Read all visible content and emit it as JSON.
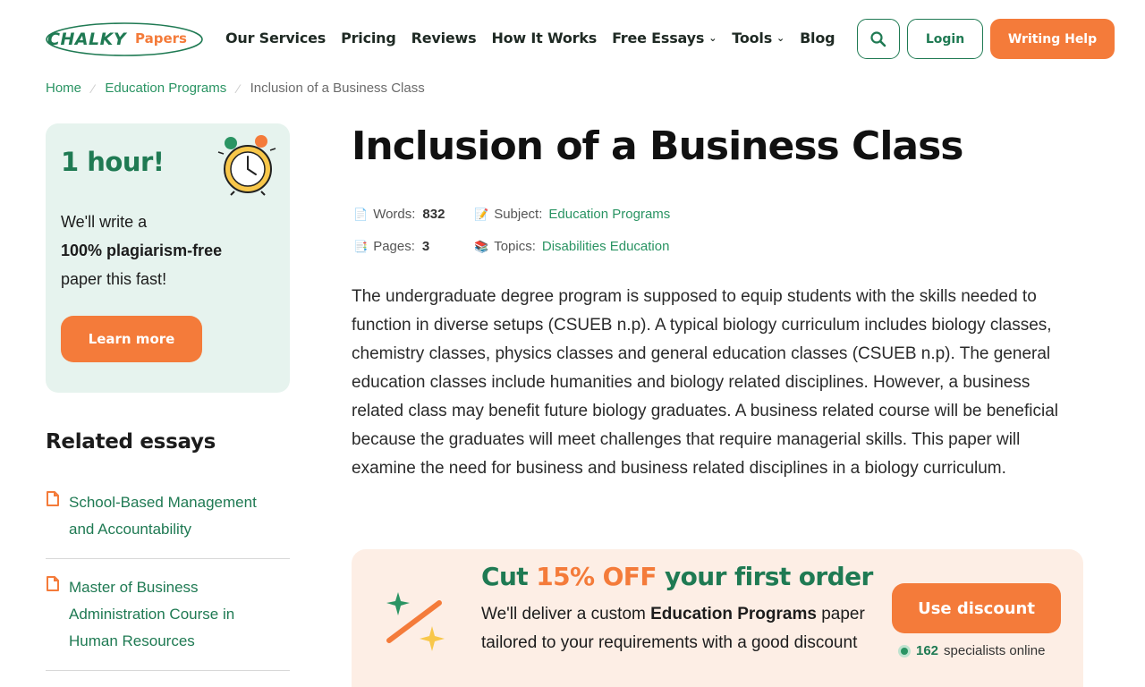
{
  "header": {
    "logo": {
      "part1": "CHALKY",
      "part2": "Papers"
    },
    "nav": [
      {
        "label": "Our Services",
        "dropdown": false
      },
      {
        "label": "Pricing",
        "dropdown": false
      },
      {
        "label": "Reviews",
        "dropdown": false
      },
      {
        "label": "How It Works",
        "dropdown": false
      },
      {
        "label": "Free Essays",
        "dropdown": true
      },
      {
        "label": "Tools",
        "dropdown": true
      },
      {
        "label": "Blog",
        "dropdown": false
      }
    ],
    "search_icon": "search-icon",
    "login_label": "Login",
    "help_label": "Writing Help"
  },
  "breadcrumb": {
    "home": "Home",
    "category": "Education Programs",
    "current": "Inclusion of a Business Class"
  },
  "promo": {
    "title": "1 hour!",
    "text_prefix": "We'll write a",
    "text_bold": "100% plagiarism-free",
    "text_suffix": "paper this fast!",
    "button": "Learn more",
    "icon": "alarm-clock-icon"
  },
  "related": {
    "title": "Related essays",
    "items": [
      {
        "title": "School-Based Management and Accountability"
      },
      {
        "title": "Master of Business Administration Course in Human Resources"
      }
    ]
  },
  "article": {
    "title": "Inclusion of a Business Class",
    "meta": {
      "words_label": "Words:",
      "words_value": "832",
      "pages_label": "Pages:",
      "pages_value": "3",
      "subject_label": "Subject:",
      "subject_value": "Education Programs",
      "topics_label": "Topics:",
      "topics_value": "Disabilities Education"
    },
    "body": "The undergraduate degree program is supposed to equip students with the skills needed to function in diverse setups (CSUEB n.p). A typical biology curriculum includes biology classes, chemistry classes, physics classes and general education classes (CSUEB n.p). The general education classes include humanities and biology related disciplines. However, a business related class may benefit future biology graduates. A business related course will be beneficial because the graduates will meet challenges that require managerial skills. This paper will examine the need for business and business related disciplines in a biology curriculum."
  },
  "discount": {
    "title_prefix": "Cut",
    "title_highlight": "15% OFF",
    "title_suffix": "your first order",
    "text_prefix": "We'll deliver a custom",
    "text_bold": "Education Programs",
    "text_suffix": "paper tailored to your requirements with a good discount",
    "button": "Use discount",
    "online_count": "162",
    "online_label": "specialists online"
  },
  "colors": {
    "brand_green": "#1f7a53",
    "link_green": "#2a9463",
    "accent_orange": "#f47b3a",
    "promo_bg": "#e6f3ee",
    "discount_bg": "#fdeee5"
  }
}
